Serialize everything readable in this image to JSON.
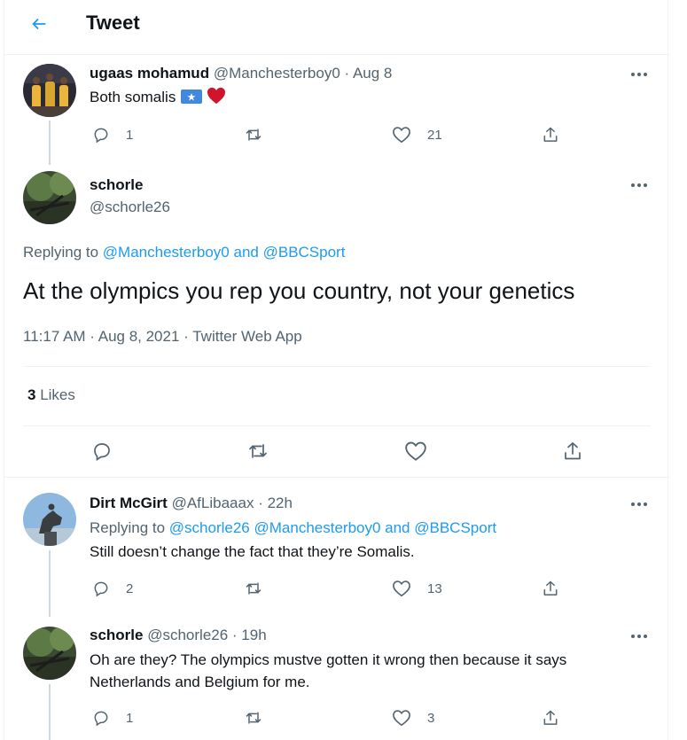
{
  "header": {
    "title": "Tweet"
  },
  "tweets": {
    "parent": {
      "name": "ugaas mohamud",
      "handle": "@Manchesterboy0",
      "time": "· Aug 8",
      "text": "Both somalis",
      "replies": "1",
      "retweets": "",
      "likes": "21"
    },
    "main": {
      "name": "schorle",
      "handle": "@schorle26",
      "replying_prefix": "Replying to",
      "replying_to_1": "@Manchesterboy0",
      "replying_and": "and",
      "replying_to_2": "@BBCSport",
      "text": "At the olympics you rep you country, not your genetics",
      "timestamp": "11:17 AM · Aug 8, 2021 · Twitter Web App",
      "likes_count": "3",
      "likes_label": "Likes"
    },
    "reply1": {
      "name": "Dirt McGirt",
      "handle": "@AfLibaaax",
      "time": "· 22h",
      "replying_prefix": "Replying to",
      "replying_to": "@schorle26 @Manchesterboy0 and @BBCSport",
      "text": "Still doesn’t change the fact that they’re Somalis.",
      "replies": "2",
      "retweets": "",
      "likes": "13"
    },
    "reply2": {
      "name": "schorle",
      "handle": "@schorle26",
      "time": "· 19h",
      "text_line1": "Oh are they? The olympics mustve gotten it wrong then because it says",
      "text_line2": "Netherlands and Belgium for me.",
      "replies": "1",
      "retweets": "",
      "likes": "3"
    }
  },
  "icons": {
    "back": "arrow-left-icon",
    "reply": "reply-icon",
    "retweet": "retweet-icon",
    "like": "heart-icon",
    "share": "share-icon",
    "more": "more-icon"
  },
  "colors": {
    "accent": "#1d9bf0",
    "text": "#0f1419",
    "muted": "#536471",
    "heart_emoji": "#d0142c",
    "flag": "#4189dd"
  }
}
